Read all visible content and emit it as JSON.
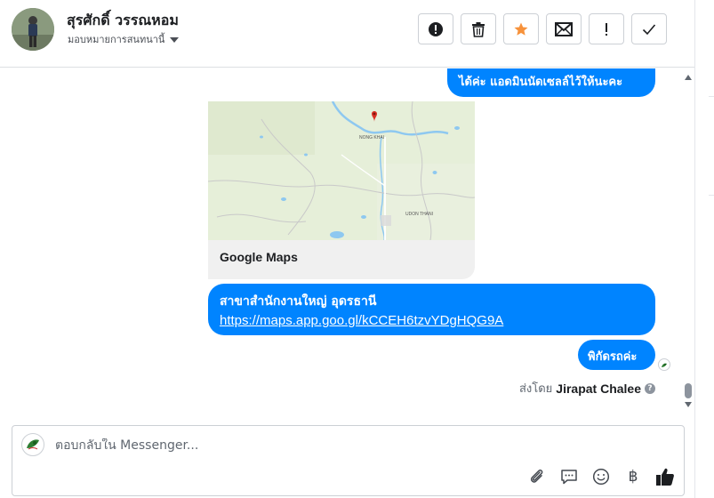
{
  "header": {
    "contact_name": "สุรศักดิ์ วรรณหอม",
    "subtitle": "มอบหมายการสนทนานี้",
    "actions": [
      {
        "name": "mark-spam-button",
        "icon": "alert-circle-icon"
      },
      {
        "name": "delete-button",
        "icon": "trash-icon"
      },
      {
        "name": "star-button",
        "icon": "star-icon"
      },
      {
        "name": "mark-unread-button",
        "icon": "envelope-icon"
      },
      {
        "name": "follow-up-button",
        "icon": "exclamation-icon"
      },
      {
        "name": "mark-done-button",
        "icon": "checkmark-icon"
      }
    ]
  },
  "messages": {
    "msg1": "ได้ค่ะ แอดมินนัดเซลล์ไว้ให้นะคะ",
    "map_card_title": "Google Maps",
    "map_labels": {
      "city1": "NONG KHAI",
      "city2": "UDON THANI"
    },
    "msg2_line1": "สาขาสำนักงานใหญ่ อุดรธานี",
    "msg2_link": "https://maps.app.goo.gl/kCCEH6tzvYDgHQG9A",
    "msg3": "พิกัดรถค่ะ",
    "sent_by_prefix": "ส่งโดย",
    "sent_by_name": "Jirapat Chalee",
    "help_glyph": "?"
  },
  "composer": {
    "placeholder": "ตอบกลับใน Messenger...",
    "tools": [
      "paperclip-icon",
      "quick-reply-icon",
      "emoji-icon",
      "payment-baht-icon",
      "thumbs-up-icon"
    ],
    "baht_glyph": "฿"
  },
  "colors": {
    "accent": "#0084ff",
    "star": "#f7923b",
    "map_water": "#8ec8f0",
    "map_land": "#e6efd9"
  }
}
